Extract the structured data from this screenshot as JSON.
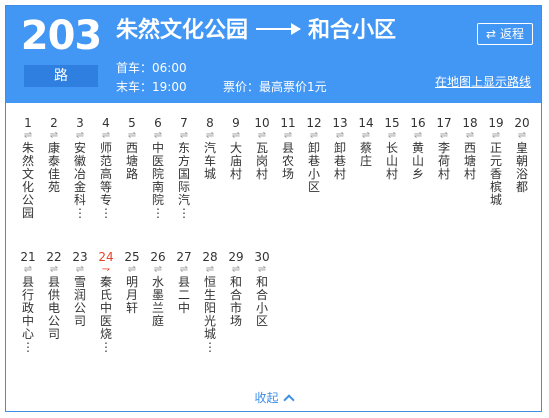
{
  "route": {
    "number": "203",
    "unit": "路"
  },
  "title": {
    "from": "朱然文化公园",
    "to": "和合小区"
  },
  "return_btn": {
    "icon": "⇄",
    "label": "返程"
  },
  "info": {
    "first": "首车：06:00",
    "last": "末车：19:00",
    "fare": "票价：最高票价1元"
  },
  "map_link": "在地图上显示路线",
  "collapse_label": "收起",
  "current_stop": 24,
  "stops": [
    {
      "i": "1",
      "name": "朱然文化公园"
    },
    {
      "i": "2",
      "name": "康泰佳苑"
    },
    {
      "i": "3",
      "name": "安徽冶金科…"
    },
    {
      "i": "4",
      "name": "师范高等专…"
    },
    {
      "i": "5",
      "name": "西塘路"
    },
    {
      "i": "6",
      "name": "中医院南院…"
    },
    {
      "i": "7",
      "name": "东方国际汽…"
    },
    {
      "i": "8",
      "name": "汽车城"
    },
    {
      "i": "9",
      "name": "大庙村"
    },
    {
      "i": "10",
      "name": "瓦岗村"
    },
    {
      "i": "11",
      "name": "县农场"
    },
    {
      "i": "12",
      "name": "卸巷小区"
    },
    {
      "i": "13",
      "name": "卸巷村"
    },
    {
      "i": "14",
      "name": "蔡庄"
    },
    {
      "i": "15",
      "name": "长山村"
    },
    {
      "i": "16",
      "name": "黄山乡"
    },
    {
      "i": "17",
      "name": "李荷村"
    },
    {
      "i": "18",
      "name": "西塘村"
    },
    {
      "i": "19",
      "name": "正元香槟城"
    },
    {
      "i": "20",
      "name": "皇朝浴都"
    },
    {
      "i": "21",
      "name": "县行政中心…"
    },
    {
      "i": "22",
      "name": "县供电公司"
    },
    {
      "i": "23",
      "name": "雪润公司"
    },
    {
      "i": "24",
      "name": "秦氏中医烧…"
    },
    {
      "i": "25",
      "name": "明月轩"
    },
    {
      "i": "26",
      "name": "水墨兰庭"
    },
    {
      "i": "27",
      "name": "县二中"
    },
    {
      "i": "28",
      "name": "恒生阳光城…"
    },
    {
      "i": "29",
      "name": "和合市场"
    },
    {
      "i": "30",
      "name": "和合小区"
    }
  ]
}
